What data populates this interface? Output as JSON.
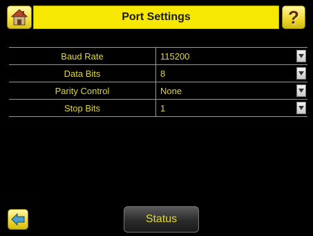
{
  "header": {
    "title": "Port Settings",
    "home_icon": "home-icon",
    "help_icon": "help-icon",
    "help_glyph": "?"
  },
  "settings": [
    {
      "label": "Baud Rate",
      "value": "115200"
    },
    {
      "label": "Data Bits",
      "value": "8"
    },
    {
      "label": "Parity Control",
      "value": "None"
    },
    {
      "label": "Stop Bits",
      "value": "1"
    }
  ],
  "footer": {
    "back_icon": "back-arrow-icon",
    "status_label": "Status"
  },
  "colors": {
    "background": "#000000",
    "title_bar": "#f6e800",
    "text_accent": "#e3d838"
  }
}
